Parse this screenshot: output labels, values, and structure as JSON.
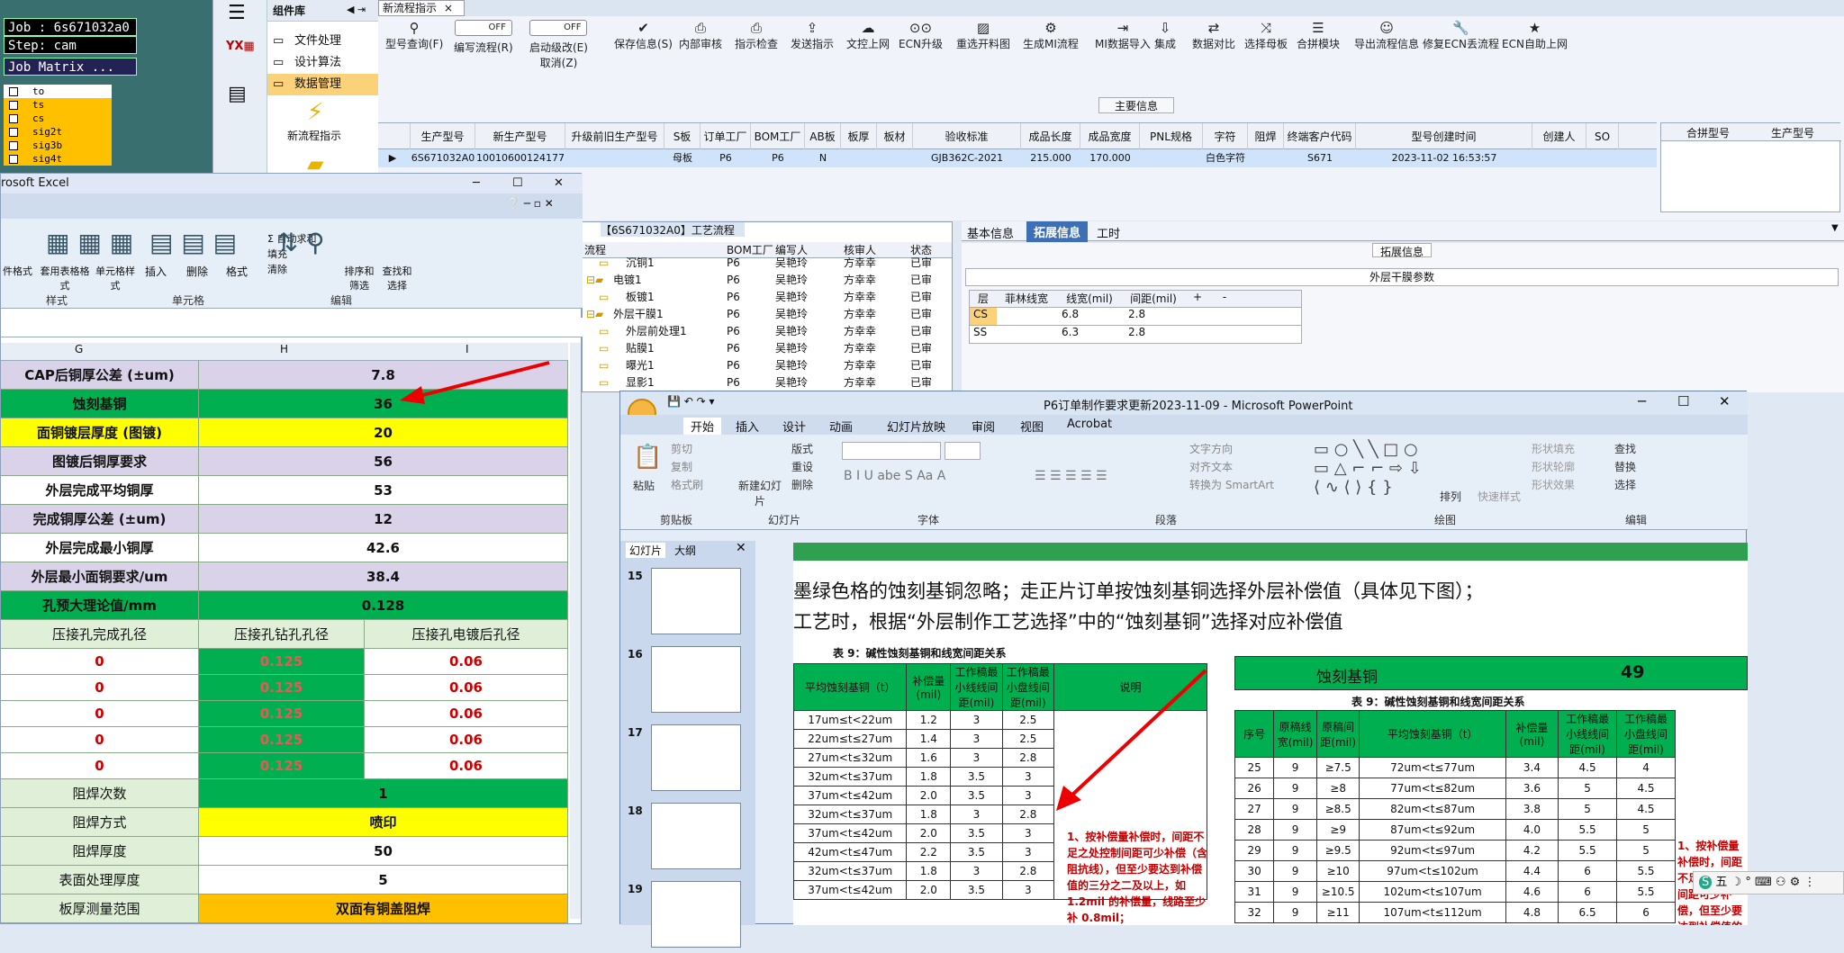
{
  "genesis": {
    "job": "Job : 6s671032a0",
    "step": "Step: cam",
    "matrix": "Job Matrix ...",
    "layers": [
      "to",
      "ts",
      "cs",
      "sig2t",
      "sig3b",
      "sig4t"
    ]
  },
  "component_lib": {
    "title": "组件库",
    "items": [
      "文件处理",
      "设计算法",
      "数据管理"
    ],
    "flow_label": "新流程指示"
  },
  "app": {
    "tab": "新流程指示",
    "toolbar": [
      {
        "l1": "型号查询(F)",
        "icon": "search-icon"
      },
      {
        "l1": "编写流程(R)",
        "icon": "toggle-icon",
        "toggle": "OFF"
      },
      {
        "l1": "启动级改(E)",
        "l2": "取消(Z)",
        "icon": "toggle-icon",
        "toggle": "OFF"
      },
      {
        "l1": "保存信息(S)",
        "icon": "check-icon"
      },
      {
        "l1": "内部审核",
        "icon": "print-icon"
      },
      {
        "l1": "指示检查",
        "icon": "print-icon"
      },
      {
        "l1": "发送指示",
        "icon": "upload-icon"
      },
      {
        "l1": "文控上网",
        "icon": "cloud-icon"
      },
      {
        "l1": "ECN升级",
        "icon": "binoculars-icon"
      },
      {
        "l1": "重选开料图",
        "icon": "image-icon"
      },
      {
        "l1": "生成MI流程",
        "icon": "gear-icon"
      },
      {
        "l1": "MI数据导入",
        "icon": "login-icon"
      },
      {
        "l1": "集成",
        "icon": "download-icon"
      },
      {
        "l1": "数据对比",
        "icon": "compare-icon"
      },
      {
        "l1": "选择母板",
        "icon": "shuffle-icon"
      },
      {
        "l1": "合拼模块",
        "icon": "list-icon"
      },
      {
        "l1": "导出流程信息",
        "icon": "smile-icon"
      },
      {
        "l1": "修复ECN丢流程",
        "icon": "wrench-icon"
      },
      {
        "l1": "ECN自助上网",
        "icon": "star-icon"
      }
    ],
    "main_info": "主要信息",
    "columns": [
      "生产型号",
      "新生产型号",
      "升级前旧生产型号",
      "S板",
      "订单工厂",
      "BOM工厂",
      "AB板",
      "板厚",
      "板材",
      "验收标准",
      "成品长度",
      "成品宽度",
      "PNL规格",
      "字符",
      "阻焊",
      "终端客户代码",
      "型号创建时间",
      "创建人",
      "SO"
    ],
    "row": [
      "6S671032A0",
      "10010600124177",
      "",
      "母板",
      "P6",
      "P6",
      "N",
      "",
      "",
      "GJB362C-2021",
      "215.000",
      "170.000",
      "",
      "白色字符",
      "",
      "S671",
      "2023-11-02 16:53:57",
      "",
      ""
    ],
    "right_cols": [
      "合拼型号",
      "生产型号"
    ],
    "tabs": [
      "基本信息",
      "拓展信息",
      "工时"
    ],
    "ext_title": "拓展信息",
    "ext_sub": "外层干膜参数",
    "ext_head": [
      "层",
      "菲林线宽",
      "线宽(mil)",
      "间距(mil)",
      "+",
      "-"
    ],
    "ext_rows": [
      [
        "CS",
        "",
        "6.8",
        "2.8"
      ],
      [
        "SS",
        "",
        "6.3",
        "2.8"
      ]
    ]
  },
  "tree": {
    "title": "【6S671032A0】工艺流程",
    "head": [
      "流程",
      "BOM工厂",
      "编写人",
      "核审人",
      "状态"
    ],
    "rows": [
      [
        "沉铜1",
        "P6",
        "吴艳玲",
        "方幸幸",
        "已审"
      ],
      [
        "电镀1",
        "P6",
        "吴艳玲",
        "方幸幸",
        "已审"
      ],
      [
        "板镀1",
        "P6",
        "吴艳玲",
        "方幸幸",
        "已审"
      ],
      [
        "外层干膜1",
        "P6",
        "吴艳玲",
        "方幸幸",
        "已审"
      ],
      [
        "外层前处理1",
        "P6",
        "吴艳玲",
        "方幸幸",
        "已审"
      ],
      [
        "贴膜1",
        "P6",
        "吴艳玲",
        "方幸幸",
        "已审"
      ],
      [
        "曝光1",
        "P6",
        "吴艳玲",
        "方幸幸",
        "已审"
      ],
      [
        "显影1",
        "P6",
        "吴艳玲",
        "方幸幸",
        "已审"
      ]
    ]
  },
  "excel": {
    "title": "rosoft Excel",
    "groups": [
      "样式",
      "单元格",
      "编辑"
    ],
    "btns": [
      "件格式",
      "套用表格格式",
      "单元格样式",
      "插入",
      "删除",
      "格式",
      "排序和筛选",
      "查找和选择"
    ],
    "edit": [
      "Σ 自动求和",
      "填充",
      "清除"
    ],
    "cols": [
      "G",
      "H",
      "I"
    ],
    "rows": [
      {
        "l": "CAP后铜厚公差 (±um)",
        "v": "7.8",
        "c": "lav"
      },
      {
        "l": "蚀刻基铜",
        "v": "36",
        "c": "grn"
      },
      {
        "l": "面铜镀层厚度 (图镀)",
        "v": "20",
        "c": "yel"
      },
      {
        "l": "图镀后铜厚要求",
        "v": "56",
        "c": "lav"
      },
      {
        "l": "外层完成平均铜厚",
        "v": "53",
        "c": "wht"
      },
      {
        "l": "完成铜厚公差 (±um)",
        "v": "12",
        "c": "lav"
      },
      {
        "l": "外层完成最小铜厚",
        "v": "42.6",
        "c": "wht"
      },
      {
        "l": "外层最小面铜要求/um",
        "v": "38.4",
        "c": "lav"
      },
      {
        "l": "孔预大理论值/mm",
        "v": "0.128",
        "c": "grn"
      }
    ],
    "press_head": [
      "压接孔完成孔径",
      "压接孔钻孔孔径",
      "压接孔电镀后孔径"
    ],
    "press_rows": [
      [
        "0",
        "0.125",
        "0.06"
      ],
      [
        "0",
        "0.125",
        "0.06"
      ],
      [
        "0",
        "0.125",
        "0.06"
      ],
      [
        "0",
        "0.125",
        "0.06"
      ],
      [
        "0",
        "0.125",
        "0.06"
      ]
    ],
    "tail": [
      {
        "l": "阻焊次数",
        "v": "1",
        "c": "grn"
      },
      {
        "l": "阻焊方式",
        "v": "喷印",
        "c": "yel"
      },
      {
        "l": "阻焊厚度",
        "v": "50",
        "c": "wht"
      },
      {
        "l": "表面处理厚度",
        "v": "5",
        "c": "wht"
      },
      {
        "l": "板厚测量范围",
        "v": "双面有铜盖阻焊",
        "c": "org"
      }
    ]
  },
  "ppt": {
    "title": "P6订单制作要求更新2023-11-09 - Microsoft PowerPoint",
    "tabs": [
      "开始",
      "插入",
      "设计",
      "动画",
      "幻灯片放映",
      "审阅",
      "视图",
      "Acrobat"
    ],
    "groups": [
      "剪贴板",
      "幻灯片",
      "字体",
      "段落",
      "绘图",
      "编辑"
    ],
    "clip": [
      "剪切",
      "复制",
      "格式刷"
    ],
    "paste": "粘贴",
    "newslide": "新建幻灯片",
    "slide_btns": [
      "版式",
      "重设",
      "删除"
    ],
    "para": [
      "文字方向",
      "对齐文本",
      "转换为 SmartArt"
    ],
    "draw": [
      "排列",
      "快速样式",
      "形状填充",
      "形状轮廓",
      "形状效果"
    ],
    "edit": [
      "查找",
      "替换",
      "选择"
    ],
    "panel_tabs": [
      "幻灯片",
      "大纲"
    ],
    "slide_nums": [
      "15",
      "16",
      "17",
      "18",
      "19"
    ],
    "line1": "墨绿色格的蚀刻基铜忽略；走正片订单按蚀刻基铜选择外层补偿值（具体见下图）；",
    "line2": "工艺时，根据“外层制作工艺选择”中的“蚀刻基铜”选择对应补偿值",
    "t9_title": "表 9：碱性蚀刻基铜和线宽间距关系",
    "t9_head": [
      "平均蚀刻基铜（t）",
      "补偿量(mil)",
      "工作稿最小线线间距(mil)",
      "工作稿最小盘线间距(mil)",
      "说明"
    ],
    "t9_rows": [
      [
        "17um≤t<22um",
        "1.2",
        "3",
        "2.5"
      ],
      [
        "22um≤t≤27um",
        "1.4",
        "3",
        "2.5"
      ],
      [
        "27um<t≤32um",
        "1.6",
        "3",
        "2.8"
      ],
      [
        "32um<t≤37um",
        "1.8",
        "3.5",
        "3"
      ],
      [
        "37um<t≤42um",
        "2.0",
        "3.5",
        "3"
      ],
      [
        "32um<t≤37um",
        "1.8",
        "3",
        "2.8"
      ],
      [
        "37um<t≤42um",
        "2.0",
        "3.5",
        "3"
      ],
      [
        "42um<t≤47um",
        "2.2",
        "3.5",
        "3"
      ],
      [
        "32um<t≤37um",
        "1.8",
        "3",
        "2.8"
      ],
      [
        "37um<t≤42um",
        "2.0",
        "3.5",
        "3"
      ]
    ],
    "t9_note": "1、按补偿量补偿时，间距不足之处控制间距可少补偿（含阻抗线），但至少要达到补偿值的三分之二及以上，如 1.2mil 的补偿量，线路至少补 0.8mil；",
    "etch_label": "蚀刻基铜",
    "etch_val": "49",
    "r_title": "表 9：碱性蚀刻基铜和线宽间距关系",
    "r_head": [
      "序号",
      "原稿线宽(mil)",
      "原稿间距(mil)",
      "平均蚀刻基铜（t）",
      "补偿量(mil)",
      "工作稿最小线线间距(mil)",
      "工作稿最小盘线间距(mil)"
    ],
    "r_rows": [
      [
        "25",
        "9",
        "≥7.5",
        "72um<t≤77um",
        "3.4",
        "4.5",
        "4"
      ],
      [
        "26",
        "9",
        "≥8",
        "77um<t≤82um",
        "3.6",
        "5",
        "4.5"
      ],
      [
        "27",
        "9",
        "≥8.5",
        "82um<t≤87um",
        "3.8",
        "5",
        "4.5"
      ],
      [
        "28",
        "9",
        "≥9",
        "87um<t≤92um",
        "4.0",
        "5.5",
        "5"
      ],
      [
        "29",
        "9",
        "≥9.5",
        "92um<t≤97um",
        "4.2",
        "5.5",
        "5"
      ],
      [
        "30",
        "9",
        "≥10",
        "97um<t≤102um",
        "4.4",
        "6",
        "5.5"
      ],
      [
        "31",
        "9",
        "≥10.5",
        "102um<t≤107um",
        "4.6",
        "6",
        "5.5"
      ],
      [
        "32",
        "9",
        "≥11",
        "107um<t≤112um",
        "4.8",
        "6.5",
        "6"
      ]
    ],
    "r_note": "1、按补偿量补偿时，间距不足之处控制间距可少补偿，但至少要达到补偿值的三分之二及以上，如"
  },
  "ime": "五"
}
